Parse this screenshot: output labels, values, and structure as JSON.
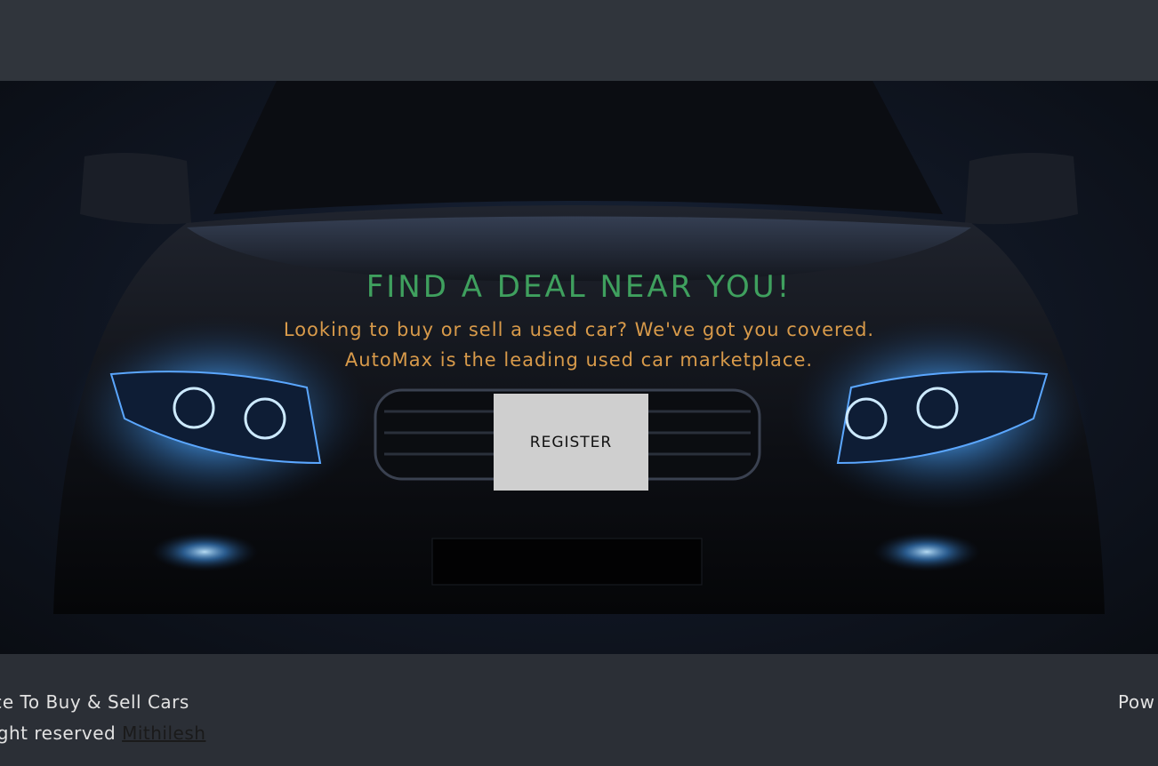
{
  "hero": {
    "headline": "FIND A DEAL NEAR YOU!",
    "subline_1": "Looking to buy or sell a used car? We've got you covered.",
    "subline_2": "AutoMax is the leading used car marketplace.",
    "register_label": "REGISTER"
  },
  "footer": {
    "tagline": "Place To Buy & Sell Cars",
    "copyright_prefix": "right reserved",
    "author_link": "Mithilesh",
    "powered_text": "Pow"
  },
  "colors": {
    "headline": "#3fa05e",
    "subline": "#d89a4a",
    "button_bg": "#cfcfcf",
    "footer_bg": "#2b2f36"
  }
}
